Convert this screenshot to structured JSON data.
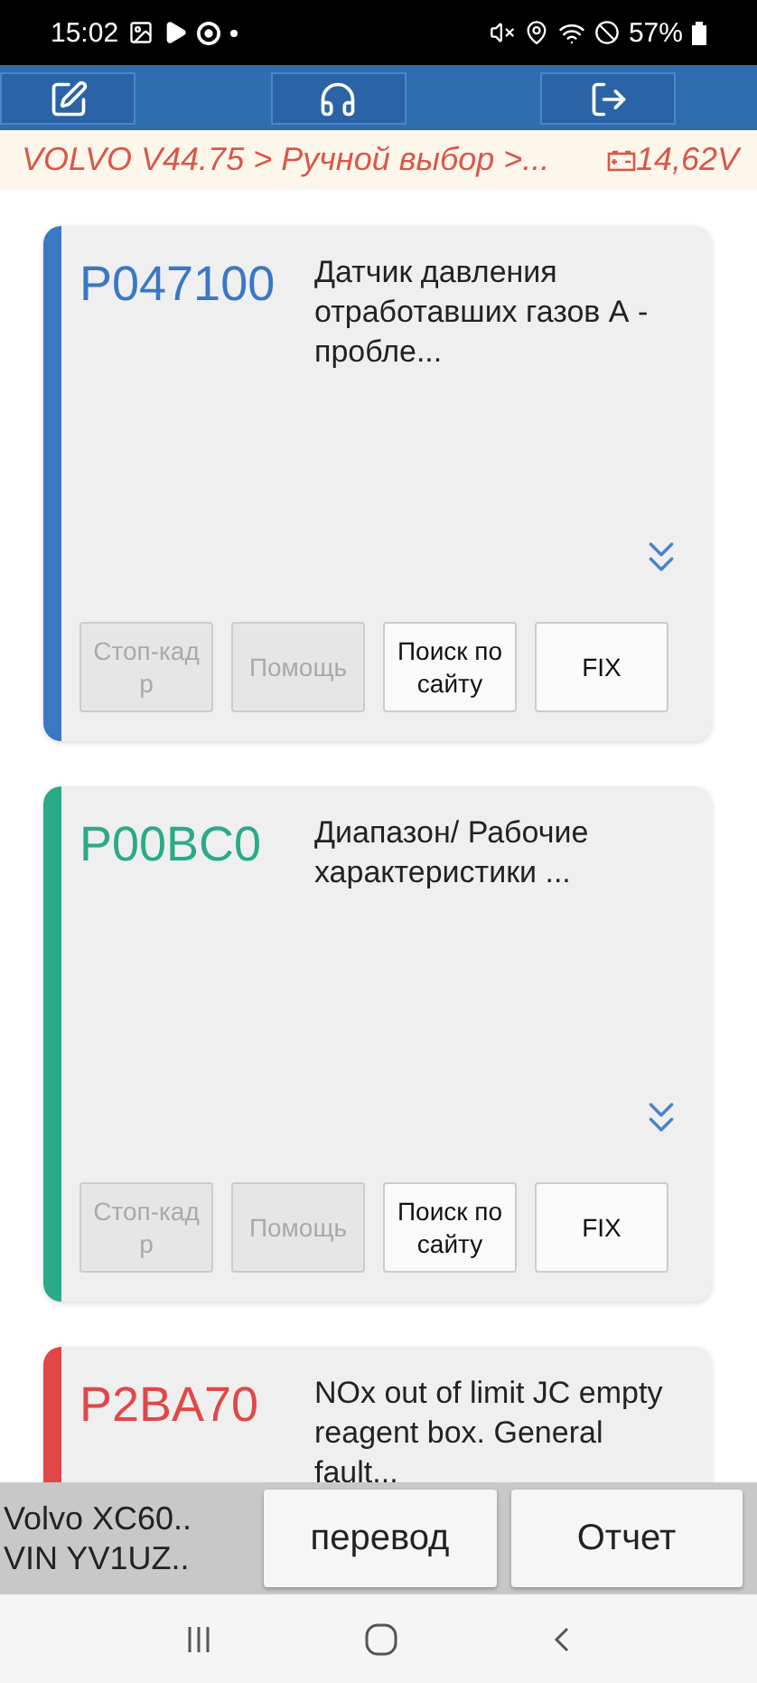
{
  "status_bar": {
    "time": "15:02",
    "battery": "57%"
  },
  "breadcrumb": {
    "path": "VOLVO V44.75 > Ручной выбор >...",
    "voltage": "14,62V"
  },
  "dtcs": [
    {
      "code": "P047100",
      "color": "#3a78c4",
      "description": "Датчик давления отработавших газов А - пробле...",
      "buttons": [
        {
          "label": "Стоп-кадр",
          "disabled": true
        },
        {
          "label": "Помощь",
          "disabled": true
        },
        {
          "label": "Поиск по сайту",
          "disabled": false
        },
        {
          "label": "FIX",
          "disabled": false
        }
      ]
    },
    {
      "code": "P00BC0",
      "color": "#2aaa88",
      "description": "Диапазон/ Рабочие характеристики ...",
      "buttons": [
        {
          "label": "Стоп-кадр",
          "disabled": true
        },
        {
          "label": "Помощь",
          "disabled": true
        },
        {
          "label": "Поиск по сайту",
          "disabled": false
        },
        {
          "label": "FIX",
          "disabled": false
        }
      ]
    },
    {
      "code": "P2BA70",
      "color": "#e04848",
      "description": "NOx out of limit JC empty reagent box. General fault..."
    }
  ],
  "vehicle": [
    "Volvo XC60..",
    "VIN YV1UZ.."
  ],
  "actions": [
    "перевод",
    "Отчет"
  ]
}
